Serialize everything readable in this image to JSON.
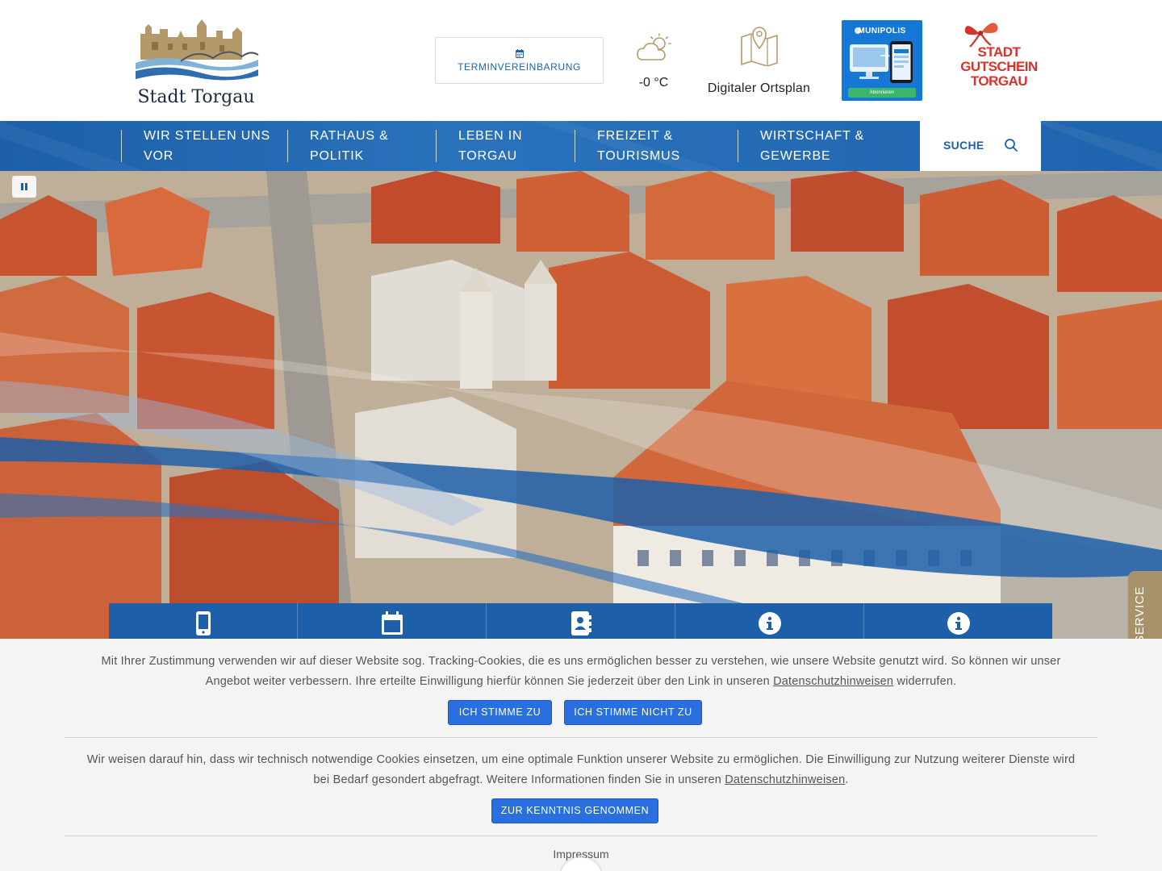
{
  "header": {
    "logo_text": "Stadt Torgau",
    "appointment_label": "TERMINVEREINBARUNG",
    "weather_temp": "-0 °C",
    "city_map_label": "Digitaler Ortsplan",
    "munipolis": {
      "title": "MUNIPOLIS",
      "button": "Abonnieren"
    },
    "voucher_lines": [
      "STADT",
      "GUTSCHEIN",
      "TORGAU"
    ]
  },
  "nav": {
    "items": [
      {
        "line1": "WIR STELLEN UNS",
        "line2": "VOR"
      },
      {
        "line1": "RATHAUS &",
        "line2": "POLITIK"
      },
      {
        "line1": "LEBEN IN",
        "line2": "TORGAU"
      },
      {
        "line1": "FREIZEIT &",
        "line2": "TOURISMUS"
      },
      {
        "line1": "WIRTSCHAFT &",
        "line2": "GEWERBE"
      }
    ],
    "search_label": "SUCHE"
  },
  "quick_links": {
    "icons": [
      "mobile-phone-icon",
      "calendar-icon",
      "address-book-icon",
      "info-icon",
      "info-icon"
    ]
  },
  "service_tab": {
    "label": "SERVICE"
  },
  "cookie": {
    "tracking_text_1": "Mit Ihrer Zustimmung verwenden wir auf dieser Website sog. Tracking-Cookies, die es uns ermöglichen besser zu verstehen, wie unsere Website genutzt wird. So können wir unser Angebot weiter verbessern. Ihre erteilte Einwilligung hierfür können Sie jederzeit über den Link in unseren ",
    "tracking_link": "Datenschutzhinweisen",
    "tracking_text_2": " widerrufen.",
    "accept_label": "ICH STIMME ZU",
    "decline_label": "ICH STIMME NICHT ZU",
    "necessary_text_1": "Wir weisen darauf hin, dass wir technisch notwendige Cookies einsetzen, um eine optimale Funktion unserer Website zu ermöglichen. Die Einwilligung zur Nutzung weiterer Dienste wird bei Bedarf gesondert abgefragt. Weitere Informationen finden Sie in unseren ",
    "necessary_link": "Datenschutzhinweisen",
    "necessary_text_2": ".",
    "acknowledge_label": "ZUR KENNTNIS GENOMMEN",
    "impressum_label": "Impressum"
  },
  "colors": {
    "brand_blue": "#1d5fa9",
    "button_blue": "#2a6fe0",
    "service_tan": "#a8926a",
    "voucher_red": "#d7332b"
  }
}
